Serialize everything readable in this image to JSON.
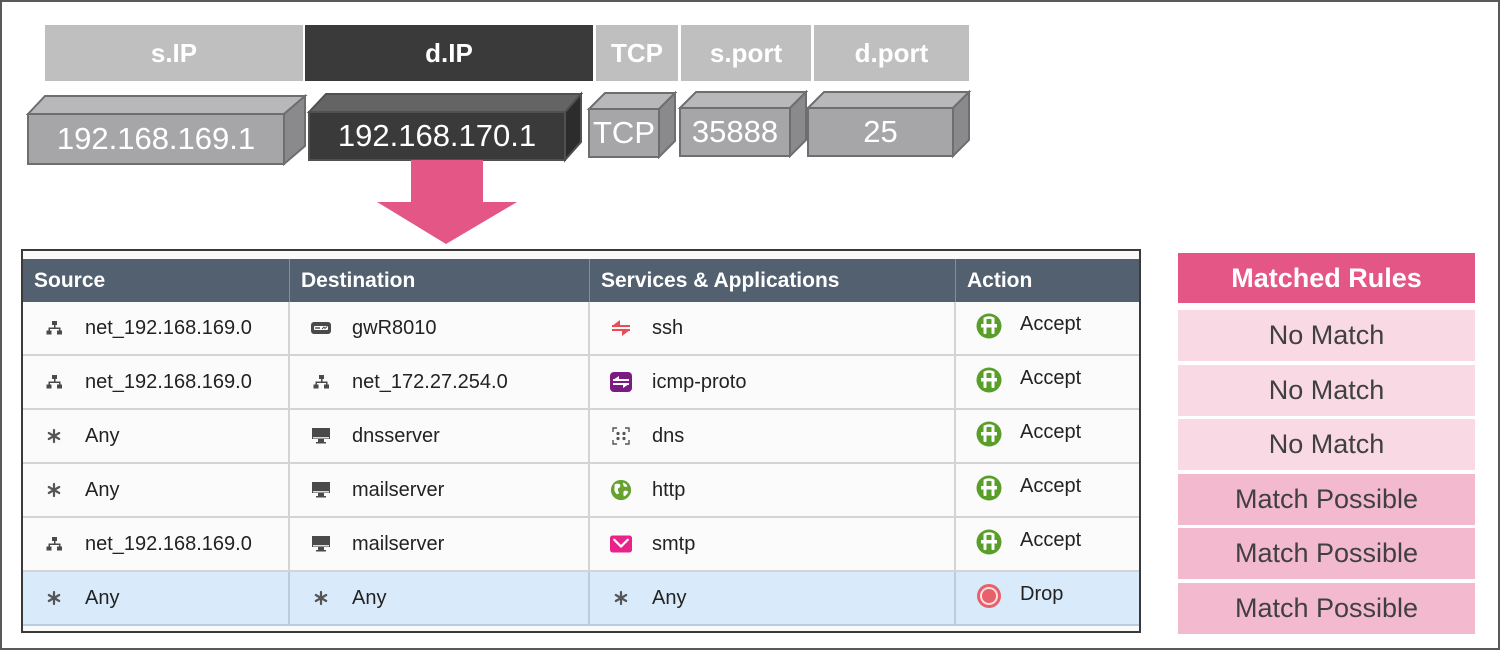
{
  "packet": {
    "headers": [
      {
        "key": "sip",
        "label": "s.IP",
        "style": "light"
      },
      {
        "key": "dip",
        "label": "d.IP",
        "style": "dark"
      },
      {
        "key": "proto",
        "label": "TCP",
        "style": "light"
      },
      {
        "key": "sport",
        "label": "s.port",
        "style": "light"
      },
      {
        "key": "dport",
        "label": "d.port",
        "style": "light"
      }
    ],
    "values": {
      "sip": "192.168.169.1",
      "dip": "192.168.170.1",
      "proto": "TCP",
      "sport": "35888",
      "dport": "25"
    },
    "highlighted_field": "dip"
  },
  "colors": {
    "accent_pink": "#e35685",
    "no_match_bg": "#f9d9e4",
    "match_possible_bg": "#f3b9ce",
    "table_header_bg": "#536070",
    "selected_row_bg": "#d9eafb",
    "accept_green": "#5a9e2a",
    "drop_red": "#e8606a",
    "box_gray": "#a6a6a8",
    "box_dark": "#3a3a3a"
  },
  "rule_table": {
    "columns": [
      "Source",
      "Destination",
      "Services & Applications",
      "Action"
    ],
    "rows": [
      {
        "source": "net_192.168.169.0",
        "source_icon": "network-icon",
        "destination": "gwR8010",
        "destination_icon": "gateway-icon",
        "service": "ssh",
        "service_icon": "ssh-icon",
        "action": "Accept",
        "action_icon": "accept-icon"
      },
      {
        "source": "net_192.168.169.0",
        "source_icon": "network-icon",
        "destination": "net_172.27.254.0",
        "destination_icon": "network-icon",
        "service": "icmp-proto",
        "service_icon": "icmp-icon",
        "action": "Accept",
        "action_icon": "accept-icon"
      },
      {
        "source": "Any",
        "source_icon": "any-icon",
        "destination": "dnsserver",
        "destination_icon": "host-icon",
        "service": "dns",
        "service_icon": "dns-icon",
        "action": "Accept",
        "action_icon": "accept-icon"
      },
      {
        "source": "Any",
        "source_icon": "any-icon",
        "destination": "mailserver",
        "destination_icon": "host-icon",
        "service": "http",
        "service_icon": "globe-icon",
        "action": "Accept",
        "action_icon": "accept-icon"
      },
      {
        "source": "net_192.168.169.0",
        "source_icon": "network-icon",
        "destination": "mailserver",
        "destination_icon": "host-icon",
        "service": "smtp",
        "service_icon": "mail-icon",
        "action": "Accept",
        "action_icon": "accept-icon"
      },
      {
        "source": "Any",
        "source_icon": "any-icon",
        "destination": "Any",
        "destination_icon": "any-icon",
        "service": "Any",
        "service_icon": "any-icon",
        "action": "Drop",
        "action_icon": "drop-icon",
        "selected": true
      }
    ]
  },
  "matched_rules": {
    "title": "Matched Rules",
    "results": [
      "No Match",
      "No Match",
      "No Match",
      "Match Possible",
      "Match Possible",
      "Match Possible"
    ]
  }
}
